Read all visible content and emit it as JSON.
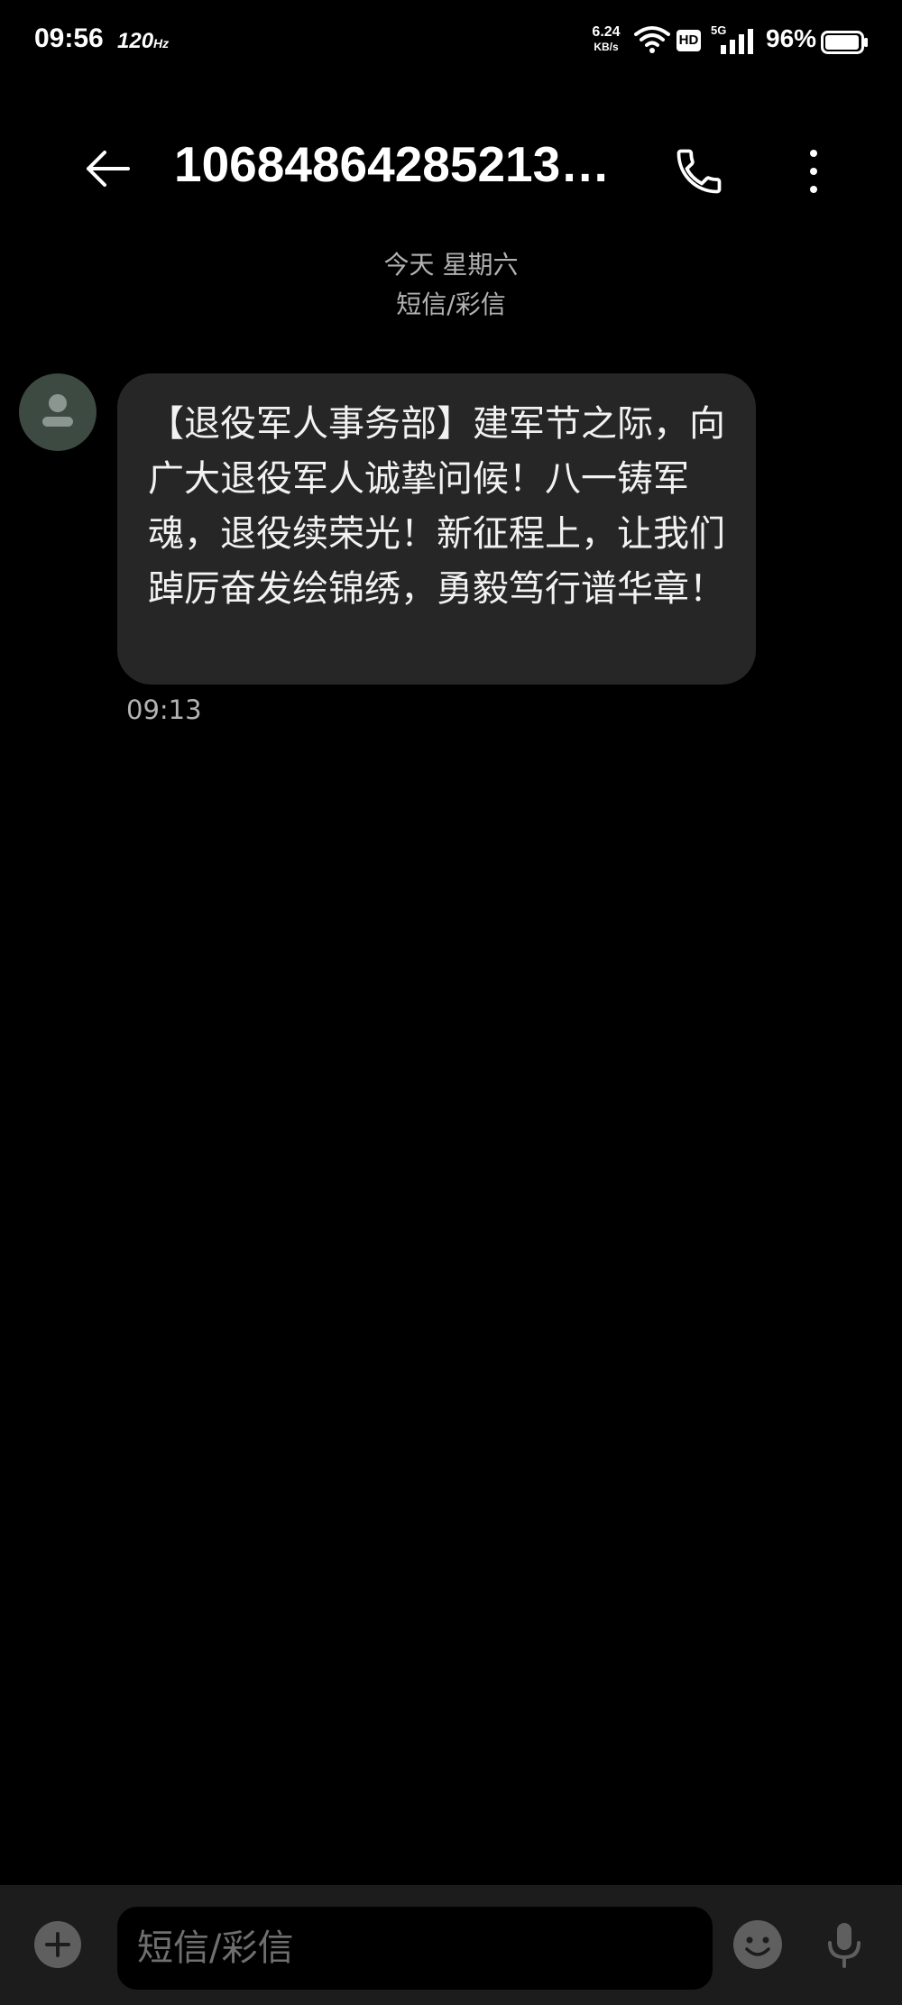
{
  "status_bar": {
    "time": "09:56",
    "refresh_rate": "120",
    "refresh_unit": "Hz",
    "net_speed_value": "6.24",
    "net_speed_unit": "KB/s",
    "hd_badge": "HD",
    "network_type": "5G",
    "battery_percent": "96%",
    "icons": [
      "wifi-icon",
      "signal-icon",
      "battery-icon"
    ]
  },
  "header": {
    "title": "10684864285213…",
    "icons": [
      "back-arrow-icon",
      "phone-icon",
      "more-vertical-icon"
    ]
  },
  "conversation": {
    "date_label": "今天 星期六",
    "channel_label": "短信/彩信",
    "messages": [
      {
        "text": "【退役军人事务部】建军节之际，向广大退役军人诚挚问候！八一铸军魂，退役续荣光！新征程上，让我们踔厉奋发绘锦绣，勇毅笃行谱华章！",
        "time": "09:13"
      }
    ]
  },
  "input_bar": {
    "placeholder": "短信/彩信",
    "icons": [
      "add-icon",
      "emoji-icon",
      "microphone-icon"
    ]
  },
  "colors": {
    "background": "#000000",
    "bubble": "#262626",
    "avatar": "#3c4a42",
    "secondary_text": "#b3b3b3",
    "input_bar": "#1c1c1c"
  }
}
